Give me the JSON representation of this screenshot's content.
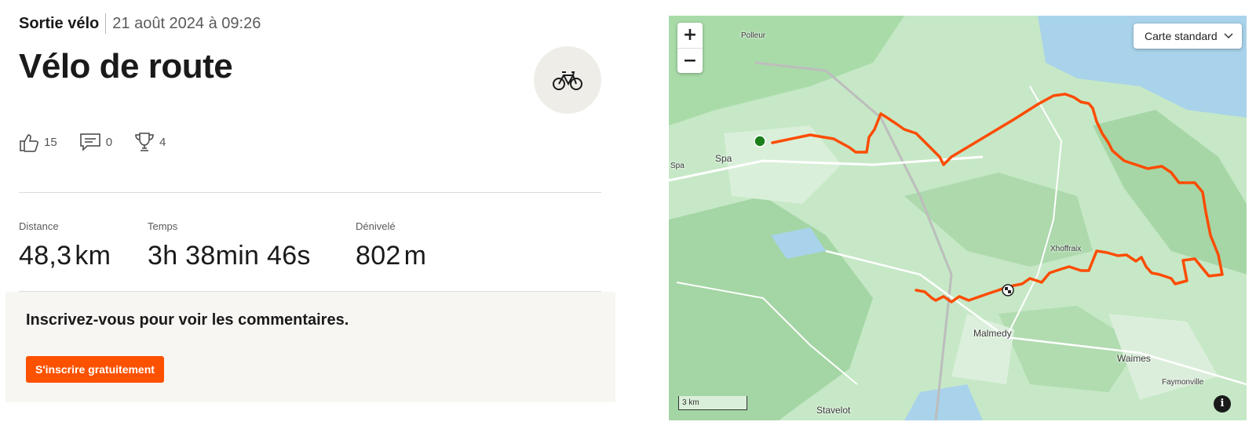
{
  "activity": {
    "type_label": "Sortie vélo",
    "date": "21 août 2024 à 09:26",
    "title": "Vélo de route",
    "sport_icon": "bike-icon"
  },
  "social": {
    "kudos": "15",
    "comments": "0",
    "achievements": "4"
  },
  "stats": [
    {
      "label": "Distance",
      "value": "48,3",
      "unit": "km"
    },
    {
      "label": "Temps",
      "value": "3h 38min 46s",
      "unit": ""
    },
    {
      "label": "Dénivelé",
      "value": "802",
      "unit": "m"
    }
  ],
  "comments": {
    "message": "Inscrivez-vous pour voir les commentaires.",
    "signup_label": "S'inscrire gratuitement"
  },
  "map": {
    "zoom_in": "+",
    "zoom_out": "−",
    "style_label": "Carte standard",
    "scale_label": "3 km",
    "info_label": "i",
    "places": {
      "polleur": "Polleur",
      "spa_left": "Spa",
      "spa": "Spa",
      "xhoffraix": "Xhoffraix",
      "malmedy": "Malmedy",
      "waimes": "Waimes",
      "faymonville": "Faymonville",
      "stavelot": "Stavelot"
    },
    "colors": {
      "route": "#fc4c02",
      "start": "#1a7f1a",
      "water": "#a9d3ea",
      "forest": "#a6d9a8"
    }
  }
}
